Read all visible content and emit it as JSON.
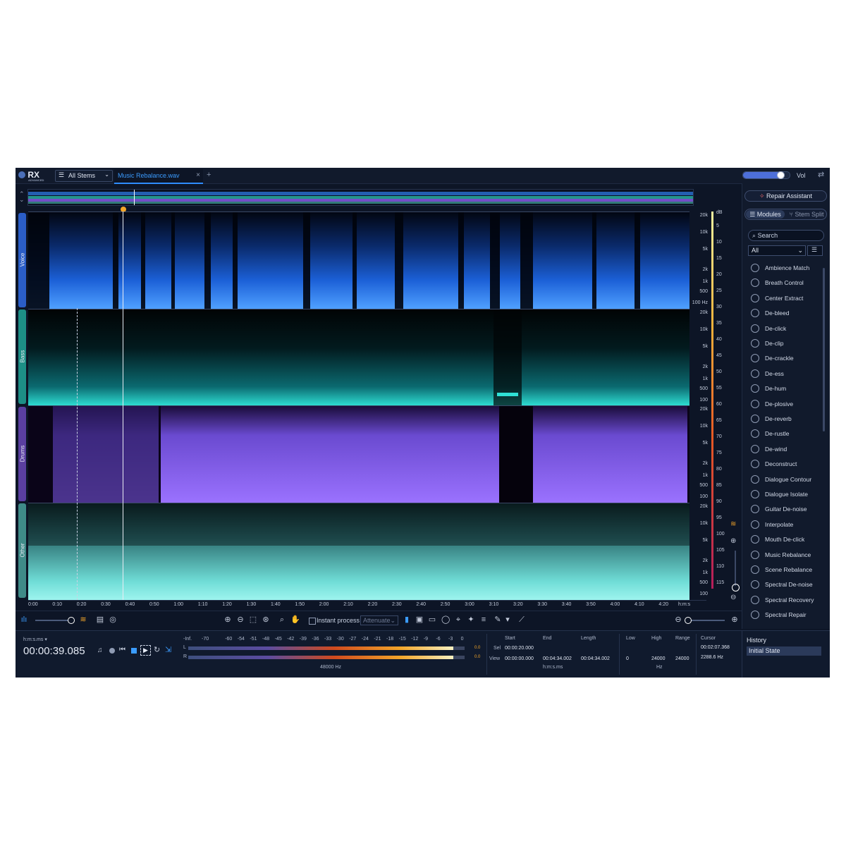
{
  "titlebar": {
    "logo": "RX",
    "logo_sub": "ADVANCED",
    "stems_label": "All Stems",
    "file_tab": "Music Rebalance.wav",
    "close": "×",
    "new_tab": "+",
    "vol_label": "Vol",
    "vol_level": 0.8
  },
  "lanes": [
    {
      "label": "Voice",
      "color": "#2b5ec7"
    },
    {
      "label": "Bass",
      "color": "#1d8f86"
    },
    {
      "label": "Drums",
      "color": "#5a3fa0"
    },
    {
      "label": "Other",
      "color": "#3f8b88"
    }
  ],
  "freq_labels": [
    "20k",
    "10k",
    "5k",
    "2k",
    "1k",
    "500",
    "100"
  ],
  "freq_unit": "Hz",
  "db_unit": "dB",
  "db_labels": [
    "5",
    "10",
    "15",
    "20",
    "25",
    "30",
    "35",
    "40",
    "45",
    "50",
    "55",
    "60",
    "65",
    "70",
    "75",
    "80",
    "85",
    "90",
    "95",
    "100",
    "105",
    "110",
    "115"
  ],
  "time_labels": [
    "0:00",
    "0:10",
    "0:20",
    "0:30",
    "0:40",
    "0:50",
    "1:00",
    "1:10",
    "1:20",
    "1:30",
    "1:40",
    "1:50",
    "2:00",
    "2:10",
    "2:20",
    "2:30",
    "2:40",
    "2:50",
    "3:00",
    "3:10",
    "3:20",
    "3:30",
    "3:40",
    "3:50",
    "4:00",
    "4:10",
    "4:20",
    "h:m:s"
  ],
  "toolbar": {
    "instant_process": "Instant process",
    "attenuate": "Attenuate"
  },
  "transport": {
    "time_format": "h:m:s.ms",
    "time": "00:00:39.085"
  },
  "meter": {
    "scale": [
      "-Inf.",
      "-70",
      "-60",
      "-54",
      "-51",
      "-48",
      "-45",
      "-42",
      "-39",
      "-36",
      "-33",
      "-30",
      "-27",
      "-24",
      "-21",
      "-18",
      "-15",
      "-12",
      "-9",
      "-6",
      "-3",
      "0"
    ],
    "L": "L",
    "R": "R",
    "L_peak": "0.0",
    "R_peak": "0.0",
    "sample_rate": "48000 Hz",
    "L_level": 0.96,
    "R_level": 0.96
  },
  "selection": {
    "start": "Start",
    "end": "End",
    "length": "Length",
    "sel": "Sel",
    "view": "View",
    "sel_start": "00:00:20.000",
    "view_start": "00:00:00.000",
    "view_end": "00:04:34.002",
    "view_length": "00:04:34.002",
    "unit": "h:m:s.ms"
  },
  "freq_range": {
    "low": "Low",
    "high": "High",
    "range": "Range",
    "low_val": "0",
    "high_val": "24000",
    "range_val": "24000",
    "unit": "Hz"
  },
  "cursor": {
    "label": "Cursor",
    "time": "00:02:07.368",
    "freq": "2288.6 Hz"
  },
  "rpanel": {
    "repair": "Repair Assistant",
    "modules": "Modules",
    "stem_split": "Stem Split",
    "search": "Search",
    "filter": "All",
    "modules_list": [
      "Ambience Match",
      "Breath Control",
      "Center Extract",
      "De-bleed",
      "De-click",
      "De-clip",
      "De-crackle",
      "De-ess",
      "De-hum",
      "De-plosive",
      "De-reverb",
      "De-rustle",
      "De-wind",
      "Deconstruct",
      "Dialogue Contour",
      "Dialogue Isolate",
      "Guitar De-noise",
      "Interpolate",
      "Mouth De-click",
      "Music Rebalance",
      "Scene Rebalance",
      "Spectral De-noise",
      "Spectral Recovery",
      "Spectral Repair"
    ]
  },
  "history": {
    "title": "History",
    "item": "Initial State"
  }
}
